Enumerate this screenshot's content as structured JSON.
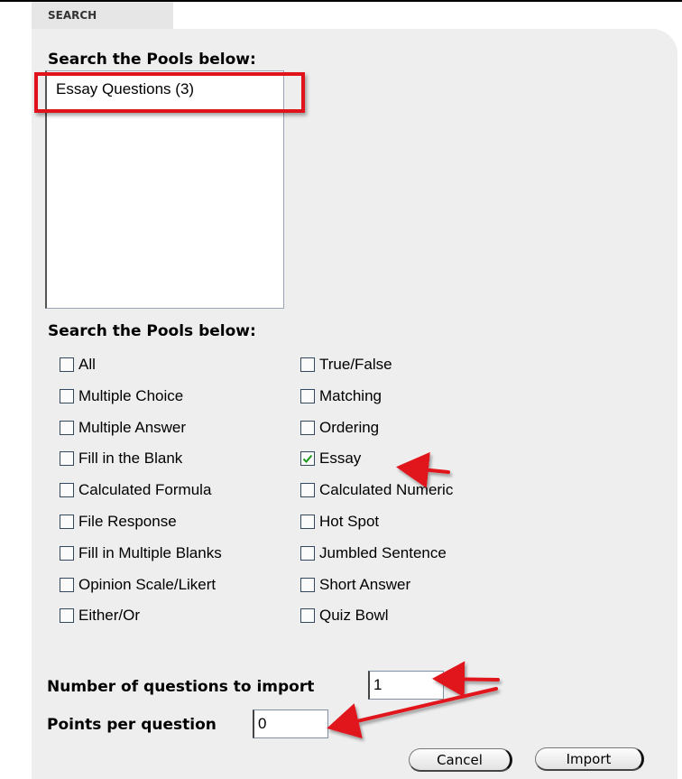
{
  "tab": {
    "label": "SEARCH"
  },
  "pools": {
    "heading": "Search the Pools below:",
    "items": [
      "Essay Questions (3)"
    ]
  },
  "types": {
    "heading": "Search the Pools below:",
    "left": [
      {
        "label": "All",
        "checked": false
      },
      {
        "label": "Multiple Choice",
        "checked": false
      },
      {
        "label": "Multiple Answer",
        "checked": false
      },
      {
        "label": "Fill in the Blank",
        "checked": false
      },
      {
        "label": "Calculated Formula",
        "checked": false
      },
      {
        "label": "File Response",
        "checked": false
      },
      {
        "label": "Fill in Multiple Blanks",
        "checked": false
      },
      {
        "label": "Opinion Scale/Likert",
        "checked": false
      },
      {
        "label": "Either/Or",
        "checked": false
      }
    ],
    "right": [
      {
        "label": "True/False",
        "checked": false
      },
      {
        "label": "Matching",
        "checked": false
      },
      {
        "label": "Ordering",
        "checked": false
      },
      {
        "label": "Essay",
        "checked": true
      },
      {
        "label": "Calculated Numeric",
        "checked": false
      },
      {
        "label": "Hot Spot",
        "checked": false
      },
      {
        "label": "Jumbled Sentence",
        "checked": false
      },
      {
        "label": "Short Answer",
        "checked": false
      },
      {
        "label": "Quiz Bowl",
        "checked": false
      }
    ]
  },
  "fields": {
    "num_questions_label": "Number of questions to import",
    "num_questions_value": "1",
    "points_label": "Points per question",
    "points_value": "0"
  },
  "buttons": {
    "cancel": "Cancel",
    "import": "Import"
  },
  "colors": {
    "annotation": "#e0121a",
    "panel": "#eeeeee",
    "checkmark": "#1a9a1a"
  }
}
